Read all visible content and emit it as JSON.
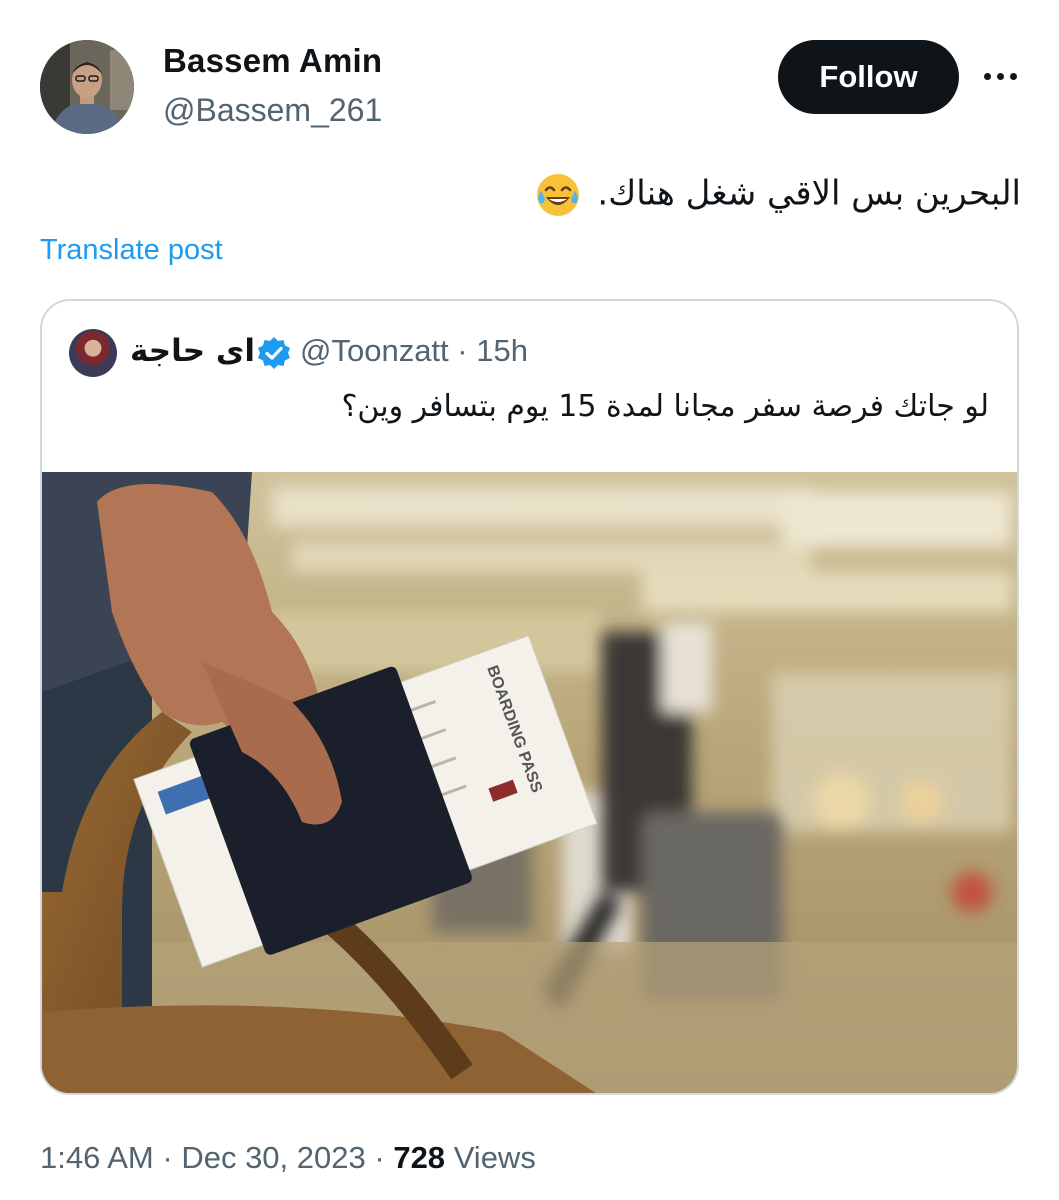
{
  "author": {
    "display_name": "Bassem Amin",
    "handle": "@Bassem_261"
  },
  "follow_label": "Follow",
  "post": {
    "text": "البحرين بس الاقي شغل هناك.",
    "emoji": "face-with-tears-of-joy-icon",
    "translate_label": "Translate post"
  },
  "quoted_post": {
    "display_name": "اى حاجة",
    "handle": "@Toonzatt",
    "separator": "·",
    "age": "15h",
    "text": "لو جاتك فرصة سفر مجانا لمدة 15 يوم بتسافر وين؟",
    "image_text": "BOARDING PASS"
  },
  "meta": {
    "time": "1:46 AM",
    "separator": "·",
    "date": "Dec 30, 2023",
    "views_count": "728",
    "views_label": "Views"
  },
  "colors": {
    "accent": "#1d9bf0",
    "text_primary": "#0f1419",
    "text_secondary": "#536471",
    "border": "#cfd9de",
    "follow_bg": "#0f1419"
  }
}
